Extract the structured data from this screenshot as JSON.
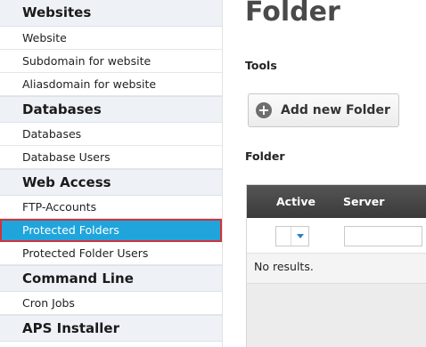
{
  "sidebar": {
    "sections": [
      {
        "title": "Websites",
        "items": [
          "Website",
          "Subdomain for website",
          "Aliasdomain for website"
        ]
      },
      {
        "title": "Databases",
        "items": [
          "Databases",
          "Database Users"
        ]
      },
      {
        "title": "Web Access",
        "items": [
          "FTP-Accounts",
          "Protected Folders",
          "Protected Folder Users"
        ]
      },
      {
        "title": "Command Line",
        "items": [
          "Cron Jobs"
        ]
      },
      {
        "title": "APS Installer",
        "items": []
      }
    ],
    "active_item": "Protected Folders"
  },
  "main": {
    "title": "Folder",
    "tools_label": "Tools",
    "add_button_label": "Add new Folder",
    "table_label": "Folder",
    "table": {
      "columns": [
        "Active",
        "Server"
      ],
      "empty_text": "No results."
    }
  },
  "colors": {
    "active_bg": "#1fa5dc",
    "active_outline": "#d3313a",
    "header_bg": "#3a3a3a"
  }
}
